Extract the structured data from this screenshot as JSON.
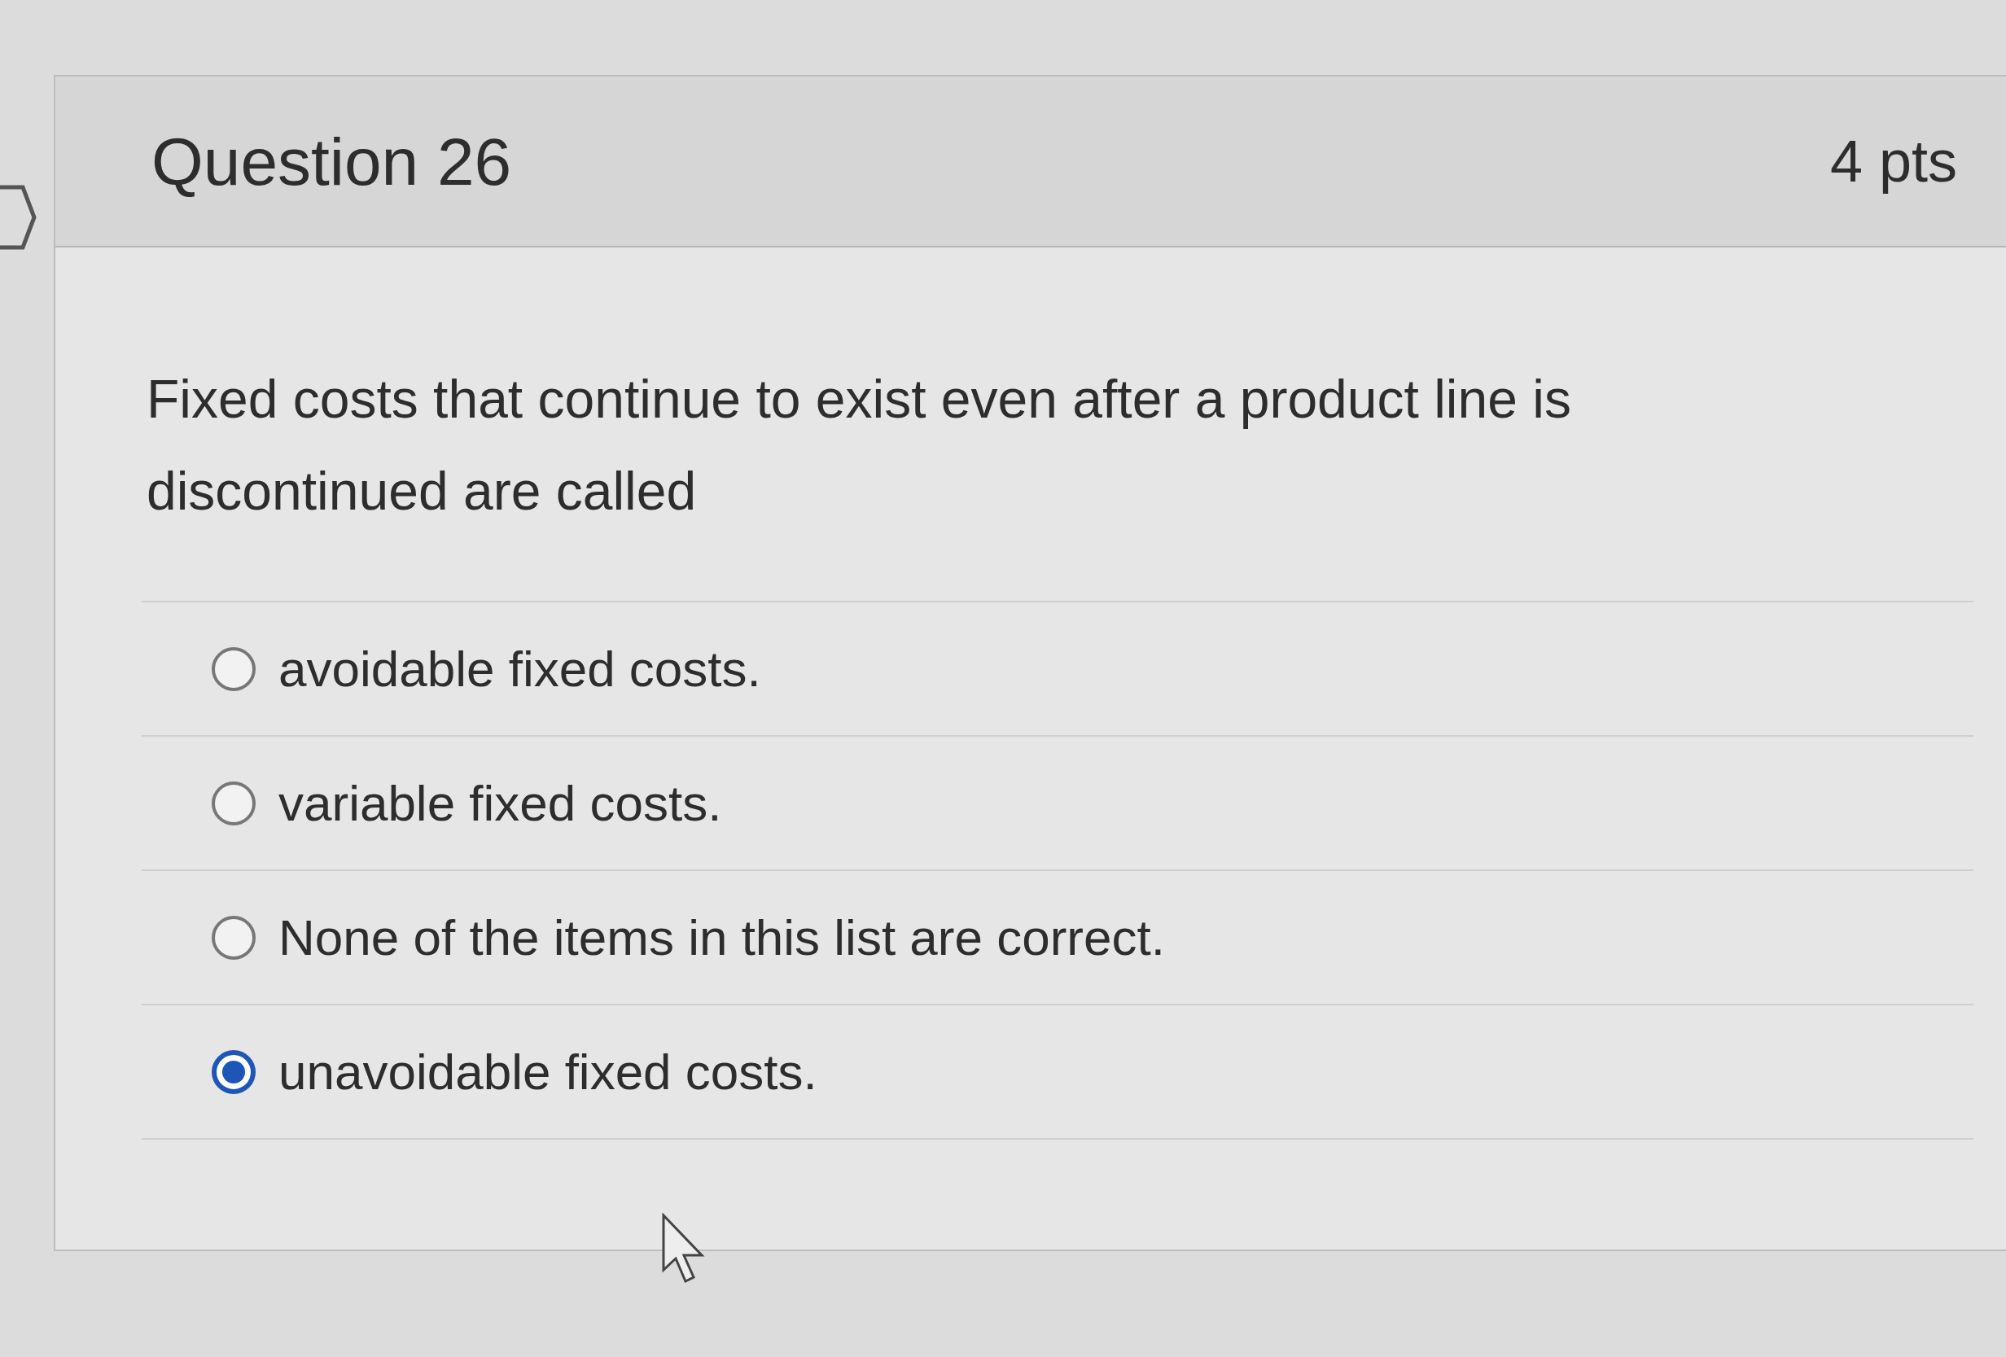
{
  "question": {
    "title": "Question 26",
    "points": "4 pts",
    "text": "Fixed costs that continue to exist even after a product line is discontinued are called",
    "answers": [
      {
        "label": "avoidable fixed costs.",
        "selected": false
      },
      {
        "label": "variable fixed costs.",
        "selected": false
      },
      {
        "label": "None of the items in this list are correct.",
        "selected": false
      },
      {
        "label": "unavoidable fixed costs.",
        "selected": true
      }
    ]
  }
}
